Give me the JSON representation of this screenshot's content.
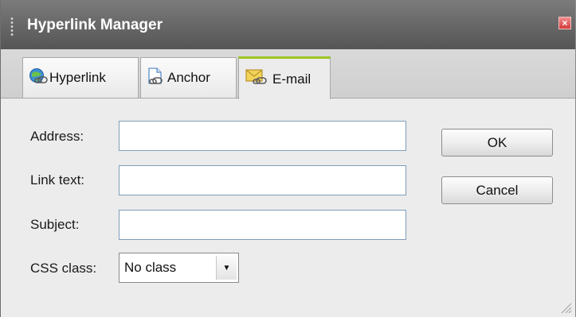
{
  "window": {
    "title": "Hyperlink Manager",
    "close_glyph": "×"
  },
  "tabs": [
    {
      "label": "Hyperlink",
      "icon": "globe-link-icon",
      "active": false
    },
    {
      "label": "Anchor",
      "icon": "document-link-icon",
      "active": false
    },
    {
      "label": "E-mail",
      "icon": "envelope-link-icon",
      "active": true
    }
  ],
  "form": {
    "address": {
      "label": "Address:",
      "value": ""
    },
    "link_text": {
      "label": "Link text:",
      "value": ""
    },
    "subject": {
      "label": "Subject:",
      "value": ""
    },
    "css_class": {
      "label": "CSS class:",
      "selected": "No class",
      "arrow": "▼"
    }
  },
  "buttons": {
    "ok": "OK",
    "cancel": "Cancel"
  },
  "colors": {
    "titlebar": "#6a6a6a",
    "active_tab_accent": "#9cc620",
    "close_button": "#d43b3b",
    "input_border": "#7f9db9",
    "panel_bg": "#ececec"
  }
}
